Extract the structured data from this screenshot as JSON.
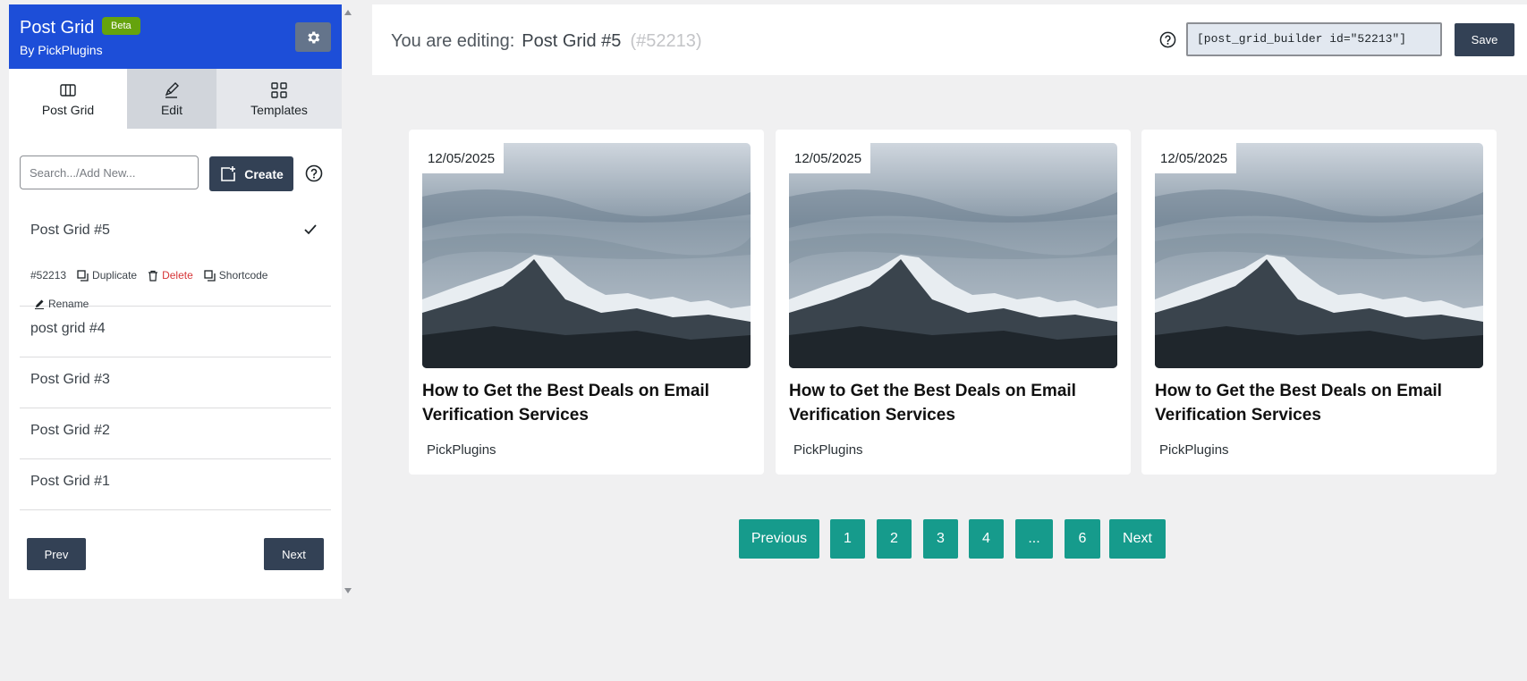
{
  "sidebar": {
    "app_title": "Post Grid",
    "badge": "Beta",
    "subtitle": "By PickPlugins",
    "settings_icon": "gear-icon",
    "tabs": [
      {
        "label": "Post Grid",
        "icon": "columns-icon"
      },
      {
        "label": "Edit",
        "icon": "brush-icon"
      },
      {
        "label": "Templates",
        "icon": "grid-icon"
      }
    ],
    "search_placeholder": "Search.../Add New...",
    "create_label": "Create",
    "items": [
      {
        "label": "Post Grid #5",
        "active": true
      },
      {
        "label": "post grid #4"
      },
      {
        "label": "Post Grid #3"
      },
      {
        "label": "Post Grid #2"
      },
      {
        "label": "Post Grid #1"
      }
    ],
    "active_actions": {
      "id": "#52213",
      "duplicate": "Duplicate",
      "delete": "Delete",
      "shortcode": "Shortcode",
      "rename": "Rename"
    },
    "prev_label": "Prev",
    "next_label": "Next"
  },
  "header": {
    "editing_label": "You are editing:",
    "post_name": "Post Grid #5",
    "post_id": "(#52213)",
    "shortcode_value": "[post_grid_builder id=\"52213\"]",
    "save_label": "Save"
  },
  "cards": [
    {
      "date": "12/05/2025",
      "title": "How to Get the Best Deals on Email Verification Services",
      "author": "PickPlugins"
    },
    {
      "date": "12/05/2025",
      "title": "How to Get the Best Deals on Email Verification Services",
      "author": "PickPlugins"
    },
    {
      "date": "12/05/2025",
      "title": "How to Get the Best Deals on Email Verification Services",
      "author": "PickPlugins"
    }
  ],
  "pagination": [
    "Previous",
    "1",
    "2",
    "3",
    "4",
    "...",
    "6",
    "Next"
  ],
  "colors": {
    "brand": "#1d4ed8",
    "beta": "#65a30d",
    "button_dark": "#334155",
    "pagination": "#169b8c",
    "delete": "#d63638"
  }
}
